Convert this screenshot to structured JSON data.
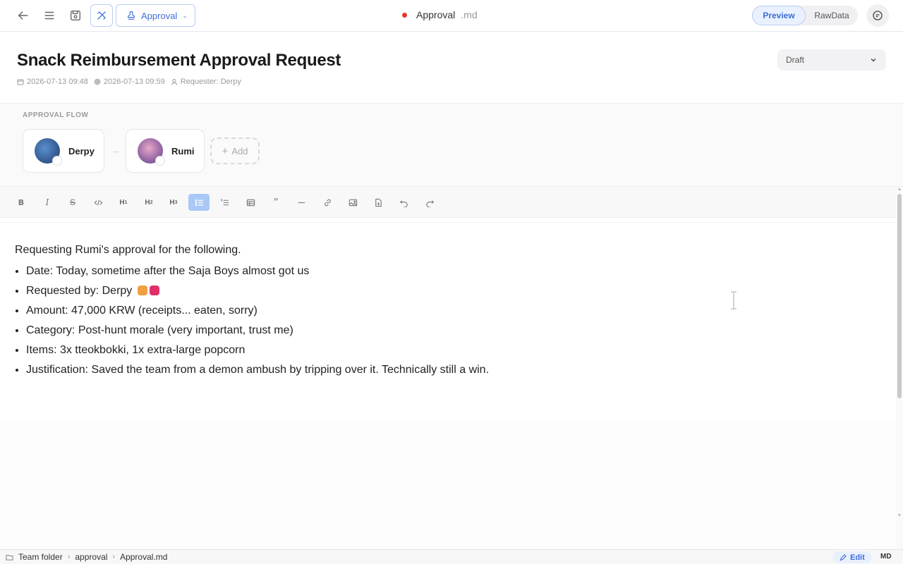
{
  "topbar": {
    "type_dropdown": "Approval",
    "doc_name": "Approval",
    "doc_ext": ".md",
    "view_modes": [
      "Preview",
      "RawData"
    ],
    "active_mode": "Preview"
  },
  "header": {
    "title": "Snack Reimbursement Approval Request",
    "created": "2026-07-13 09:48",
    "modified": "2026-07-13 09:59",
    "requester": "Requester: Derpy",
    "status": "Draft"
  },
  "approval_flow": {
    "label": "APPROVAL FLOW",
    "approvers": [
      {
        "name": "Derpy",
        "color": "#2f5f9a"
      },
      {
        "name": "Rumi",
        "color": "#7b4fa8"
      }
    ],
    "add_label": "Add"
  },
  "toolbar": {
    "tools": [
      "bold",
      "italic",
      "strikethrough",
      "code",
      "h1",
      "h2",
      "h3",
      "bullet-list",
      "ordered-list",
      "table",
      "quote",
      "divider",
      "link",
      "image",
      "file",
      "undo",
      "redo"
    ],
    "active_tool": "bullet-list"
  },
  "content": {
    "intro": "Requesting Rumi's approval for the following.",
    "items": [
      "Date: Today, sometime after the Saja Boys almost got us",
      "Requested by: Derpy",
      "Amount: 47,000 KRW (receipts... eaten, sorry)",
      "Category: Post-hunt morale (very important, trust me)",
      "Items: 3x tteokbokki, 1x extra-large popcorn",
      "Justification: Saved the team from a demon ambush by tripping over it. Technically still a win."
    ]
  },
  "statusbar": {
    "breadcrumb": [
      "Team folder",
      "approval",
      "Approval.md"
    ],
    "edit_label": "Edit",
    "format_label": "MD"
  },
  "colors": {
    "accent": "#3b6dd6",
    "unsaved_dot": "#e5362f"
  }
}
